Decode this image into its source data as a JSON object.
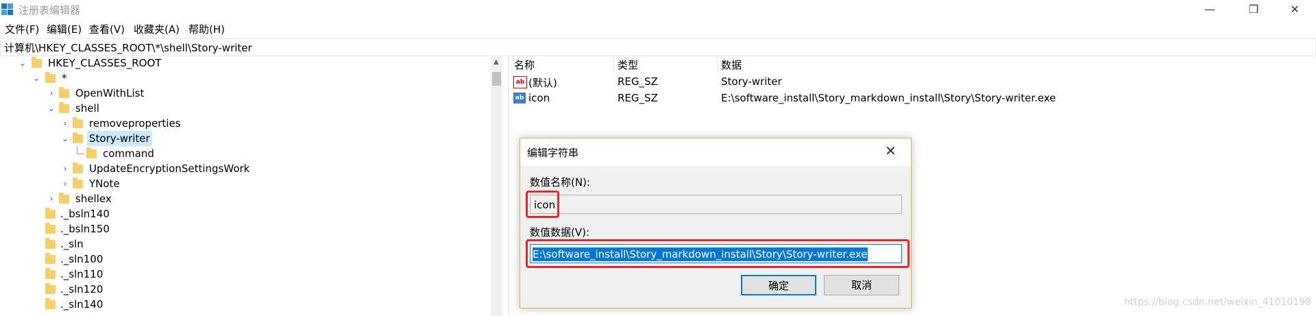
{
  "window": {
    "title": "注册表编辑器",
    "minimize": "—",
    "maximize": "❐",
    "close": "✕"
  },
  "menu": [
    "文件(F)",
    "编辑(E)",
    "查看(V)",
    "收藏夹(A)",
    "帮助(H)"
  ],
  "address": "计算机\\HKEY_CLASSES_ROOT\\*\\shell\\Story-writer",
  "tree": [
    {
      "label": "HKEY_CLASSES_ROOT",
      "expanded": true
    },
    {
      "label": "*",
      "expanded": true
    },
    {
      "label": "OpenWithList",
      "expanded": false
    },
    {
      "label": "shell",
      "expanded": true
    },
    {
      "label": "removeproperties",
      "expanded": false
    },
    {
      "label": "Story-writer",
      "expanded": true,
      "selected": true
    },
    {
      "label": "command"
    },
    {
      "label": "UpdateEncryptionSettingsWork",
      "expanded": false
    },
    {
      "label": "YNote",
      "expanded": false
    },
    {
      "label": "shellex",
      "expanded": false
    },
    {
      "label": "._bsln140"
    },
    {
      "label": "._bsln150"
    },
    {
      "label": "._sln"
    },
    {
      "label": "._sln100"
    },
    {
      "label": "._sln110"
    },
    {
      "label": "._sln120"
    },
    {
      "label": "._sln140"
    }
  ],
  "list": {
    "headers": [
      "名称",
      "类型",
      "数据"
    ],
    "rows": [
      {
        "icon": "ab",
        "name": "(默认)",
        "type": "REG_SZ",
        "data": "Story-writer"
      },
      {
        "icon": "ab",
        "name": "icon",
        "type": "REG_SZ",
        "data": "E:\\software_install\\Story_markdown_install\\Story\\Story-writer.exe"
      }
    ]
  },
  "dialog": {
    "title": "编辑字符串",
    "name_label": "数值名称(N):",
    "name_value": "icon",
    "data_label": "数值数据(V):",
    "data_value": "E:\\software_install\\Story_markdown_install\\Story\\Story-writer.exe",
    "ok": "确定",
    "cancel": "取消"
  },
  "watermark": "https://blog.csdn.net/weixin_41010198",
  "colors": {
    "selection": "#cce8ff",
    "folder": "#f6cf6a",
    "highlight_box": "#e8262a",
    "text_selection": "#0078d7"
  }
}
